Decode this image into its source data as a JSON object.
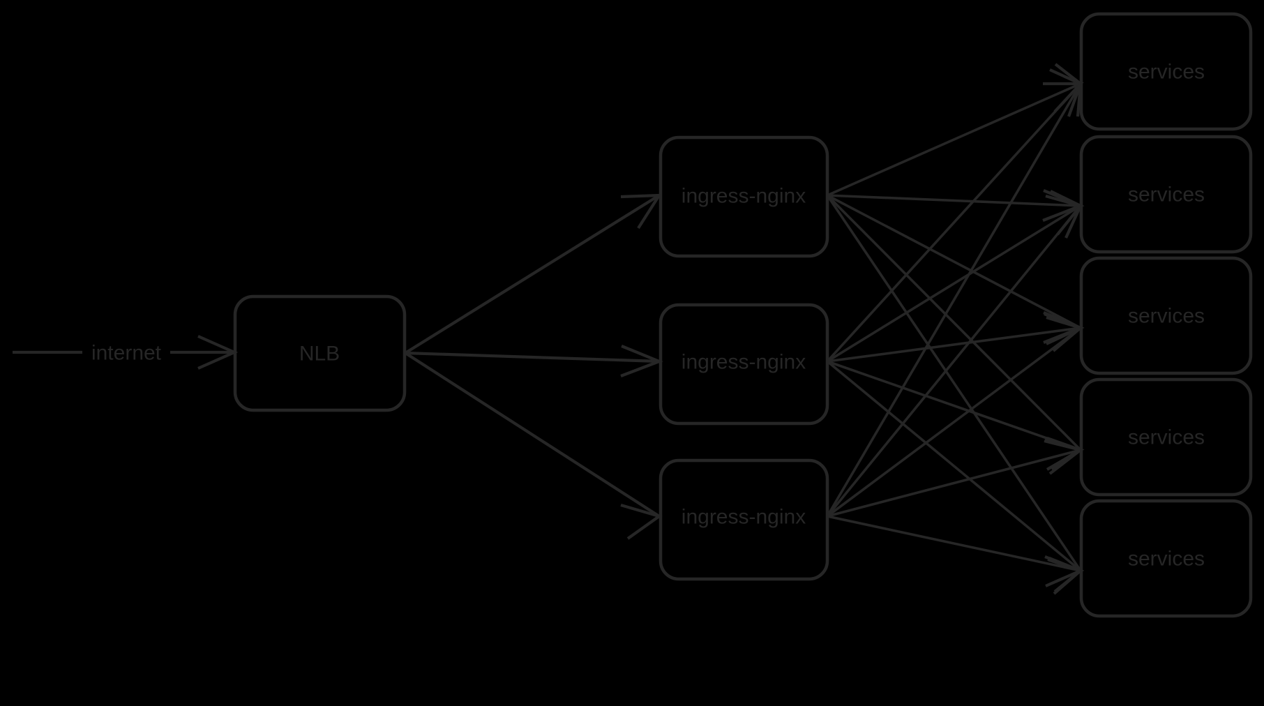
{
  "diagram": {
    "title": "",
    "background_color": "#000000",
    "stroke_color": "#262626",
    "text_color": "#262626",
    "edge_labels": [
      {
        "id": "internet",
        "text": "internet"
      }
    ],
    "columns": [
      {
        "id": "entrypoint",
        "nodes": [
          {
            "id": "nlb",
            "label": "NLB",
            "shape": "rounded-rect"
          }
        ]
      },
      {
        "id": "ingress-tier",
        "nodes": [
          {
            "id": "ingress-1",
            "label": "ingress-nginx",
            "shape": "rounded-rect"
          },
          {
            "id": "ingress-2",
            "label": "ingress-nginx",
            "shape": "rounded-rect"
          },
          {
            "id": "ingress-3",
            "label": "ingress-nginx",
            "shape": "rounded-rect"
          }
        ]
      },
      {
        "id": "services-tier",
        "nodes": [
          {
            "id": "service-1",
            "label": "services",
            "shape": "rounded-rect"
          },
          {
            "id": "service-2",
            "label": "services",
            "shape": "rounded-rect"
          },
          {
            "id": "service-3",
            "label": "services",
            "shape": "rounded-rect"
          },
          {
            "id": "service-4",
            "label": "services",
            "shape": "rounded-rect"
          },
          {
            "id": "service-5",
            "label": "services",
            "shape": "rounded-rect"
          }
        ]
      }
    ],
    "edges": [
      {
        "from": "internet",
        "to": "nlb",
        "label": "internet",
        "arrow": true
      },
      {
        "from": "nlb",
        "to": "ingress-1",
        "arrow": true
      },
      {
        "from": "nlb",
        "to": "ingress-2",
        "arrow": true
      },
      {
        "from": "nlb",
        "to": "ingress-3",
        "arrow": true
      },
      {
        "from": "ingress-1",
        "to": "service-1",
        "arrow": true
      },
      {
        "from": "ingress-1",
        "to": "service-2",
        "arrow": true
      },
      {
        "from": "ingress-1",
        "to": "service-3",
        "arrow": true
      },
      {
        "from": "ingress-1",
        "to": "service-4",
        "arrow": true
      },
      {
        "from": "ingress-1",
        "to": "service-5",
        "arrow": true
      },
      {
        "from": "ingress-2",
        "to": "service-1",
        "arrow": true
      },
      {
        "from": "ingress-2",
        "to": "service-2",
        "arrow": true
      },
      {
        "from": "ingress-2",
        "to": "service-3",
        "arrow": true
      },
      {
        "from": "ingress-2",
        "to": "service-4",
        "arrow": true
      },
      {
        "from": "ingress-2",
        "to": "service-5",
        "arrow": true
      },
      {
        "from": "ingress-3",
        "to": "service-1",
        "arrow": true
      },
      {
        "from": "ingress-3",
        "to": "service-2",
        "arrow": true
      },
      {
        "from": "ingress-3",
        "to": "service-3",
        "arrow": true
      },
      {
        "from": "ingress-3",
        "to": "service-4",
        "arrow": true
      },
      {
        "from": "ingress-3",
        "to": "service-5",
        "arrow": true
      }
    ]
  }
}
